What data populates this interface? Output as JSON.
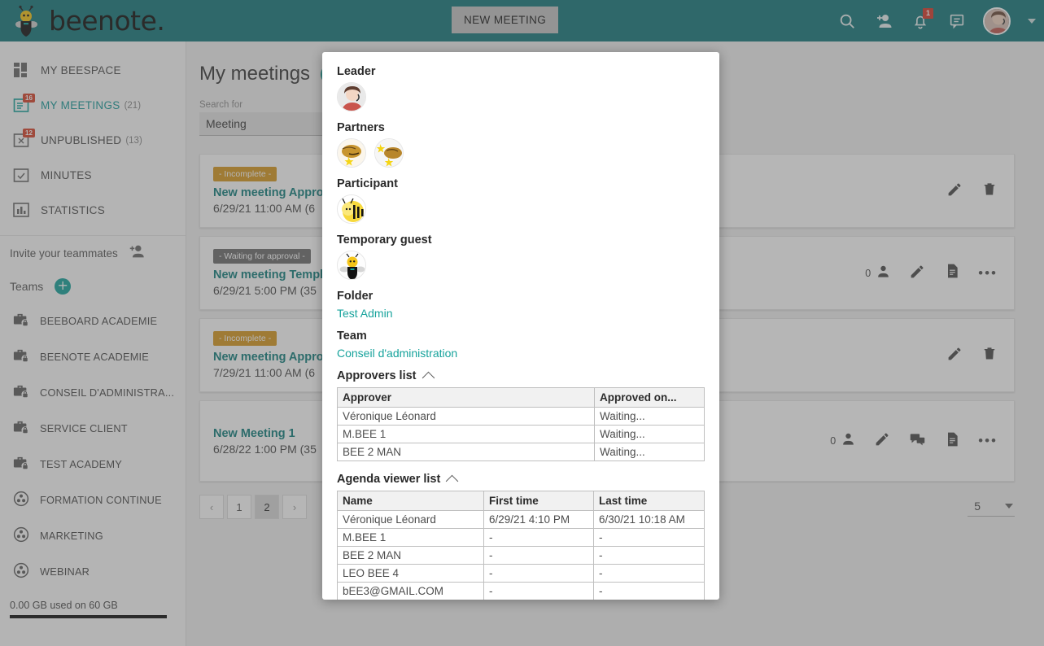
{
  "header": {
    "logo_text": "beenote.",
    "logo_icon": "bee-logo-icon",
    "new_meeting_label": "NEW MEETING",
    "search_icon": "search-icon",
    "add_person_icon": "add-person-icon",
    "bell_icon": "notification-bell-icon",
    "notification_count": "1",
    "chat_icon": "chat-bubble-icon",
    "avatar_icon": "user-avatar",
    "caret_icon": "chevron-down-icon"
  },
  "sidebar": {
    "nav": [
      {
        "label": "MY BEESPACE",
        "icon": "dashboard-icon",
        "count": "",
        "badge": "",
        "active": false
      },
      {
        "label": "MY MEETINGS",
        "icon": "meetings-calendar-icon",
        "count": "(21)",
        "badge": "16",
        "active": true
      },
      {
        "label": "UNPUBLISHED",
        "icon": "unpublished-calendar-icon",
        "count": "(13)",
        "badge": "12",
        "active": false
      },
      {
        "label": "MINUTES",
        "icon": "minutes-check-icon",
        "count": "",
        "badge": "",
        "active": false
      },
      {
        "label": "STATISTICS",
        "icon": "statistics-bars-icon",
        "count": "",
        "badge": "",
        "active": false
      }
    ],
    "invite_label": "Invite your teammates",
    "invite_icon": "invite-person-icon",
    "teams_label": "Teams",
    "teams_add_icon": "plus-circle-icon",
    "teams": [
      {
        "label": "BEEBOARD ACADEMIE",
        "icon": "private-team-briefcase-lock-icon"
      },
      {
        "label": "BEENOTE ACADEMIE",
        "icon": "private-team-briefcase-lock-icon"
      },
      {
        "label": "CONSEIL D'ADMINISTRA...",
        "icon": "private-team-briefcase-lock-icon"
      },
      {
        "label": "SERVICE CLIENT",
        "icon": "private-team-briefcase-lock-icon"
      },
      {
        "label": "TEST ACADEMY",
        "icon": "private-team-briefcase-lock-icon"
      },
      {
        "label": "FORMATION CONTINUE",
        "icon": "public-team-group-icon"
      },
      {
        "label": "MARKETING",
        "icon": "public-team-group-icon"
      },
      {
        "label": "WEBINAR",
        "icon": "public-team-group-icon"
      }
    ],
    "storage_text": "0.00 GB used on 60 GB"
  },
  "main": {
    "page_title": "My meetings",
    "add_meeting_icon": "plus-circle-icon",
    "search_label": "Search for",
    "search_value": "Meeting",
    "search_placeholder": "Search for",
    "meetings": [
      {
        "status": "- Incomplete -",
        "status_type": "incomplete",
        "title": "New meeting Approv",
        "date": "6/29/21 11:00 AM (6",
        "participants": "",
        "actions": [
          "edit-icon",
          "delete-icon"
        ]
      },
      {
        "status": "- Waiting for approval -",
        "status_type": "waiting",
        "title": "New meeting Templa",
        "date": "6/29/21 5:00 PM (35",
        "participants": "0",
        "actions": [
          "participants-icon",
          "edit-icon",
          "document-icon",
          "more-options-icon"
        ]
      },
      {
        "status": "- Incomplete -",
        "status_type": "incomplete",
        "title": "New meeting Approv",
        "date": "7/29/21 11:00 AM (6",
        "participants": "",
        "actions": [
          "edit-icon",
          "delete-icon"
        ]
      },
      {
        "status": "",
        "status_type": "",
        "title": "New Meeting 1",
        "date": "6/28/22 1:00 PM (35",
        "participants": "0",
        "actions": [
          "participants-icon",
          "edit-icon",
          "comment-icon",
          "document-icon",
          "more-options-icon"
        ]
      }
    ],
    "pagination": {
      "prev": "‹",
      "pages": [
        "1",
        "2"
      ],
      "current": "2",
      "next": "›"
    },
    "page_size": "5"
  },
  "popup": {
    "leader_label": "Leader",
    "leader_avatars": [
      "leader-avatar"
    ],
    "partners_label": "Partners",
    "partner_avatars": [
      "partner-bee-avatar-1",
      "partner-bee-avatar-2"
    ],
    "participant_label": "Participant",
    "participant_avatars": [
      "participant-bee-avatar"
    ],
    "guest_label": "Temporary guest",
    "guest_avatars": [
      "guest-bee-avatar"
    ],
    "folder_label": "Folder",
    "folder_value": "Test Admin",
    "team_label": "Team",
    "team_value": "Conseil d'administration",
    "approvers_section_label": "Approvers list",
    "approvers_collapse_icon": "chevron-up-icon",
    "approvers_headers": [
      "Approver",
      "Approved on..."
    ],
    "approvers_rows": [
      [
        "Véronique Léonard",
        "Waiting..."
      ],
      [
        "M.BEE 1",
        "Waiting..."
      ],
      [
        "BEE 2 MAN",
        "Waiting..."
      ]
    ],
    "viewers_section_label": "Agenda viewer list",
    "viewers_collapse_icon": "chevron-up-icon",
    "viewers_headers": [
      "Name",
      "First time",
      "Last time"
    ],
    "viewers_rows": [
      [
        "Véronique Léonard",
        "6/29/21 4:10 PM",
        "6/30/21 10:18 AM"
      ],
      [
        "M.BEE 1",
        "-",
        "-"
      ],
      [
        "BEE 2 MAN",
        "-",
        "-"
      ],
      [
        "LEO BEE 4",
        "-",
        "-"
      ],
      [
        "bEE3@GMAIL.COM",
        "-",
        "-"
      ]
    ]
  },
  "colors": {
    "brand_teal": "#17797c",
    "accent_teal": "#17a39c",
    "incomplete_orange": "#d79a22",
    "waiting_gray": "#6f6f6f",
    "badge_red": "#d8452e"
  }
}
